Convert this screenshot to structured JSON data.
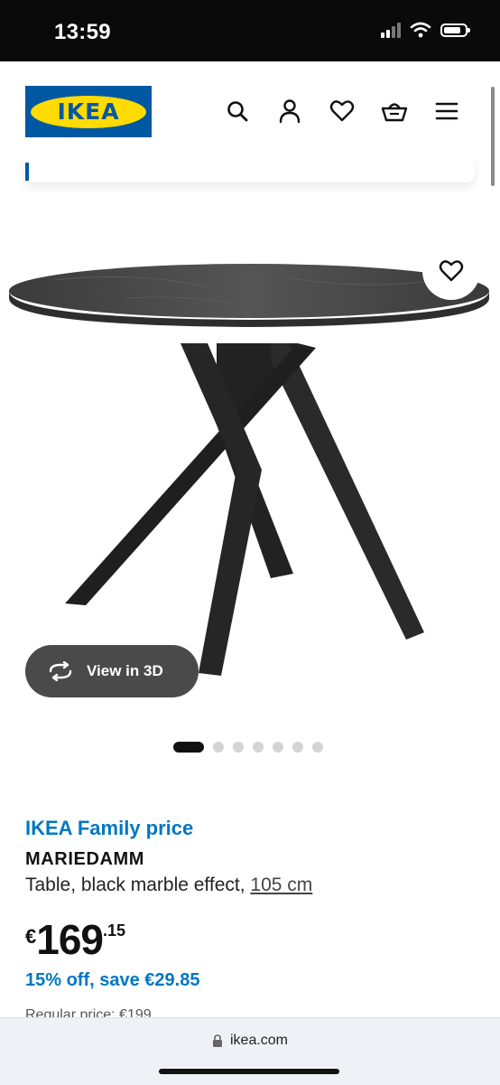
{
  "status_bar": {
    "time": "13:59"
  },
  "header": {
    "logo_text": "IKEA",
    "icons": [
      "search-icon",
      "user-icon",
      "heart-icon",
      "basket-icon",
      "menu-icon"
    ]
  },
  "gallery": {
    "view_3d_label": "View in 3D",
    "dot_count": 7,
    "active_dot": 1
  },
  "product": {
    "family_label": "IKEA Family price",
    "name": "MARIEDAMM",
    "description": "Table, black marble effect, ",
    "size_link": "105 cm",
    "price_currency": "€",
    "price_integer": "169",
    "price_decimal": ".15",
    "discount": "15% off, save €29.85",
    "regular_price": "Regular price: €199"
  },
  "browser": {
    "url": "ikea.com"
  },
  "colors": {
    "brand_blue": "#0058a3",
    "brand_yellow": "#ffdb00",
    "link_blue": "#0077c1"
  }
}
